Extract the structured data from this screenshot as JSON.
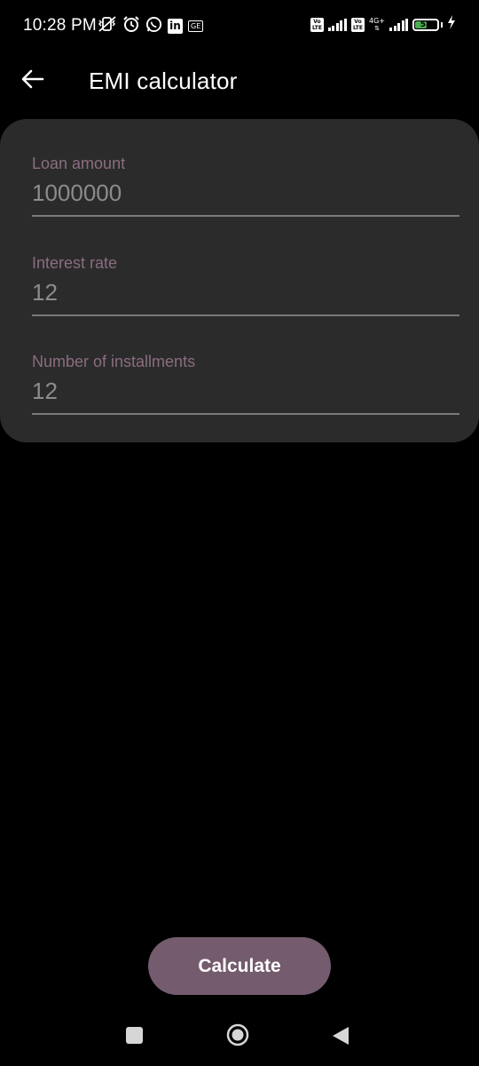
{
  "status_bar": {
    "time": "10:28 PM",
    "left_icons": [
      "vibrate-off-icon",
      "alarm-icon",
      "whatsapp-icon",
      "linkedin-icon",
      "gallery-icon"
    ],
    "linkedin_text": "in",
    "ge_text": "GE",
    "volte_label_1": "Vo\nLTE",
    "volte_label_2": "Vo\nLTE",
    "network_type": "4G+",
    "battery_level": "58",
    "battery_fraction": 0.58,
    "charging": true
  },
  "app_bar": {
    "title": "EMI calculator",
    "back_icon": "arrow-left-icon"
  },
  "form": {
    "fields": [
      {
        "label": "Loan amount",
        "value": "1000000"
      },
      {
        "label": "Interest rate",
        "value": "12"
      },
      {
        "label": "Number of installments",
        "value": "12"
      }
    ]
  },
  "actions": {
    "calculate_label": "Calculate"
  },
  "nav_bar": {
    "icons": [
      "recents-square-icon",
      "home-circle-icon",
      "back-triangle-icon"
    ]
  },
  "colors": {
    "background": "#000000",
    "card": "#2b2b2b",
    "label": "#8a6d80",
    "input_text": "#8c8c8c",
    "accent_button": "#745b6d",
    "battery_fill": "#4caf50"
  }
}
